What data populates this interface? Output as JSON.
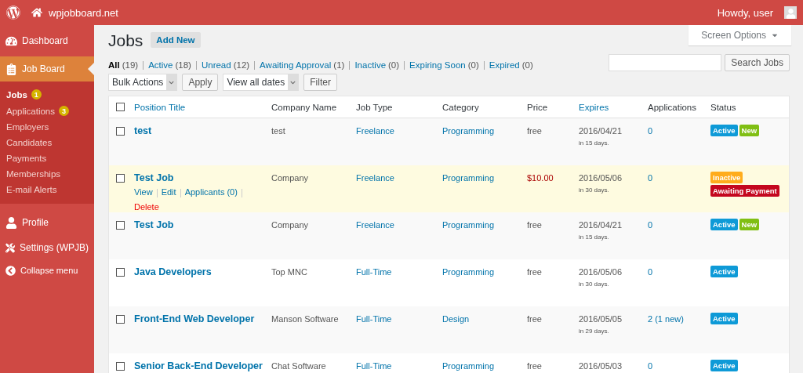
{
  "admin_bar": {
    "site": "wpjobboard.net",
    "greeting": "Howdy, user"
  },
  "sidebar": {
    "items": [
      {
        "label": "Dashboard",
        "selected": false
      },
      {
        "label": "Job Board",
        "selected": true,
        "children": [
          {
            "label": "Jobs",
            "count": "1",
            "selected": true
          },
          {
            "label": "Applications",
            "count": "3",
            "selected": false
          },
          {
            "label": "Employers",
            "selected": false
          },
          {
            "label": "Candidates",
            "selected": false
          },
          {
            "label": "Payments",
            "selected": false
          },
          {
            "label": "Memberships",
            "selected": false
          },
          {
            "label": "E-mail Alerts",
            "selected": false
          }
        ]
      },
      {
        "label": "Profile",
        "selected": false
      },
      {
        "label": "Settings (WPJB)",
        "selected": false
      },
      {
        "label": "Collapse menu",
        "selected": false
      }
    ]
  },
  "screen_options": "Screen Options",
  "page_title": "Jobs",
  "add_new": "Add New",
  "filters": [
    {
      "label": "All",
      "count": "(19)",
      "selected": true
    },
    {
      "label": "Active",
      "count": "(18)",
      "selected": false
    },
    {
      "label": "Unread",
      "count": "(12)",
      "selected": false
    },
    {
      "label": "Awaiting Approval",
      "count": "(1)",
      "selected": false
    },
    {
      "label": "Inactive",
      "count": "(0)",
      "selected": false
    },
    {
      "label": "Expiring Soon",
      "count": "(0)",
      "selected": false
    },
    {
      "label": "Expired",
      "count": "(0)",
      "selected": false
    }
  ],
  "search": {
    "button": "Search Jobs"
  },
  "bulk_actions": "Bulk Actions",
  "apply": "Apply",
  "dates": "View all dates",
  "filter": "Filter",
  "table": {
    "select_all_checked": false,
    "columns": [
      {
        "label": "Position Title",
        "sortable": true
      },
      {
        "label": "Company Name",
        "sortable": false
      },
      {
        "label": "Job Type",
        "sortable": false
      },
      {
        "label": "Category",
        "sortable": false
      },
      {
        "label": "Price",
        "sortable": false
      },
      {
        "label": "Expires",
        "sortable": true
      },
      {
        "label": "Applications",
        "sortable": false
      },
      {
        "label": "Status",
        "sortable": false
      }
    ],
    "rows": [
      {
        "title": "test",
        "company": "test",
        "type": "Freelance",
        "category": "Programming",
        "price": "free",
        "price_due": false,
        "expires": "2016/04/21",
        "expires_in": "in 15 days.",
        "applications": "0",
        "highlighted": false,
        "checked": false,
        "badges": [
          {
            "label": "Active",
            "color": "#0e9ad7"
          },
          {
            "label": "New",
            "color": "#80bf14"
          }
        ]
      },
      {
        "title": "Test Job",
        "company": "Company",
        "type": "Freelance",
        "category": "Programming",
        "price": "$10.00",
        "price_due": true,
        "expires": "2016/05/06",
        "expires_in": "in 30 days.",
        "applications": "0",
        "highlighted": true,
        "checked": false,
        "actions": [
          {
            "label": "View",
            "kind": "link"
          },
          {
            "label": "Edit",
            "kind": "link"
          },
          {
            "label": "Applicants (0)",
            "kind": "link"
          },
          {
            "label": "Delete",
            "kind": "danger"
          }
        ],
        "badges": [
          {
            "label": "Inactive",
            "color": "#ffac1c"
          },
          {
            "label": "Awaiting Payment",
            "color": "#c4071f"
          }
        ]
      },
      {
        "title": "Test Job",
        "company": "Company",
        "type": "Freelance",
        "category": "Programming",
        "price": "free",
        "price_due": false,
        "expires": "2016/04/21",
        "expires_in": "in 15 days.",
        "applications": "0",
        "highlighted": false,
        "checked": false,
        "badges": [
          {
            "label": "Active",
            "color": "#0e9ad7"
          },
          {
            "label": "New",
            "color": "#80bf14"
          }
        ]
      },
      {
        "title": "Java Developers",
        "company": "Top MNC",
        "type": "Full-Time",
        "category": "Programming",
        "price": "free",
        "price_due": false,
        "expires": "2016/05/06",
        "expires_in": "in 30 days.",
        "applications": "0",
        "highlighted": false,
        "checked": false,
        "badges": [
          {
            "label": "Active",
            "color": "#0e9ad7"
          }
        ]
      },
      {
        "title": "Front-End Web Developer",
        "company": "Manson Software",
        "type": "Full-Time",
        "category": "Design",
        "price": "free",
        "price_due": false,
        "expires": "2016/05/05",
        "expires_in": "in 29 days.",
        "applications": "2 (1 new)",
        "highlighted": false,
        "checked": false,
        "badges": [
          {
            "label": "Active",
            "color": "#0e9ad7"
          }
        ]
      },
      {
        "title": "Senior Back-End Developer",
        "company": "Chat Software",
        "type": "Full-Time",
        "category": "Programming",
        "price": "free",
        "price_due": false,
        "expires": "2016/05/03",
        "applications": "0",
        "highlighted": false,
        "checked": false,
        "badges": [
          {
            "label": "Active",
            "color": "#0e9ad7"
          }
        ]
      }
    ]
  }
}
